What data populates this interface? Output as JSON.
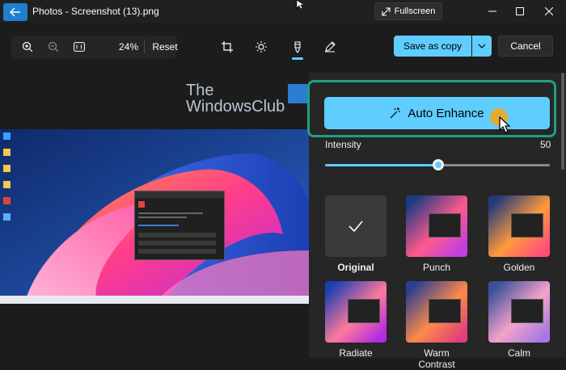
{
  "titlebar": {
    "title": "Photos - Screenshot (13).png",
    "fullscreen_label": "Fullscreen"
  },
  "zoom": {
    "value": "24%",
    "reset_label": "Reset"
  },
  "actions": {
    "save_label": "Save as copy",
    "cancel_label": "Cancel"
  },
  "watermark": {
    "line1": "The",
    "line2": "WindowsClub"
  },
  "enhance": {
    "auto_label": "Auto Enhance",
    "intensity_label": "Intensity",
    "intensity_value": "50",
    "intensity_fraction": 0.5
  },
  "filters": [
    {
      "label": "Original",
      "selected": true
    },
    {
      "label": "Punch"
    },
    {
      "label": "Golden"
    },
    {
      "label": "Radiate"
    },
    {
      "label": "Warm Contrast"
    },
    {
      "label": "Calm"
    }
  ],
  "colors": {
    "accent": "#60cdff",
    "highlight": "#1ea082",
    "cursor": "#f0a91e"
  },
  "icons": {
    "back": "back-arrow-icon",
    "fullscreen": "expand-icon",
    "zoom_in": "zoom-in-icon",
    "zoom_out": "zoom-out-icon",
    "actual_size": "actual-size-icon",
    "crop": "crop-icon",
    "adjust": "brightness-icon",
    "filter": "filter-icon",
    "markup": "pen-icon",
    "auto_enhance": "magic-wand-icon",
    "check": "checkmark-icon"
  }
}
